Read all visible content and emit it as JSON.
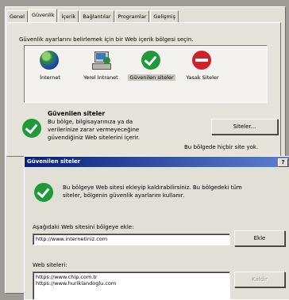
{
  "tabs": [
    "Genel",
    "Güvenlik",
    "İçerik",
    "Bağlantılar",
    "Programlar",
    "Gelişmiş"
  ],
  "active_tab": "Güvenlik",
  "zone_prompt": "Güvenlik ayarlarını belirlemek için bir Web içerik bölgesi seçin.",
  "zones": [
    {
      "label": "İnternet",
      "icon": "globe-icon"
    },
    {
      "label": "Yerel Intranet",
      "icon": "intranet-icon"
    },
    {
      "label": "Güvenilen siteler",
      "icon": "trusted-check-icon",
      "selected": true
    },
    {
      "label": "Yasak Siteler",
      "icon": "restricted-icon"
    }
  ],
  "zone_info": {
    "title": "Güvenilen siteler",
    "lines": [
      "Bu bölge, bilgisayarınıza ya da",
      "verilerinize zarar vermeyeceğine",
      "güvendiğiniz Web sitelerini içerir."
    ],
    "sites_button": "Siteler...",
    "note": "Bu bölgede hiçbir site yok."
  },
  "dialog": {
    "title": "Güvenilen siteler",
    "help_button": "?",
    "info_lines": [
      "Bu bölgeye Web sitesi ekleyip kaldırabilirsiniz. Bu bölgedeki tüm",
      "siteler, bölgenin güvenlik ayarlarını kullanır."
    ],
    "add_label": "Aşağıdaki Web sitesini bölgeye ekle:",
    "add_value": "http://www.internetiniz.com",
    "add_button": "Ekle",
    "sites_label": "Web siteleri:",
    "sites": [
      "https://www.chip.com.tr",
      "https://www.huriklandoglu.com"
    ],
    "remove_button": "Kaldır"
  },
  "colors": {
    "titlebar_start": "#0a1f79",
    "titlebar_end": "#5d7fd0",
    "trusted_green": "#1f9a3a",
    "restricted_red": "#d0202a"
  }
}
